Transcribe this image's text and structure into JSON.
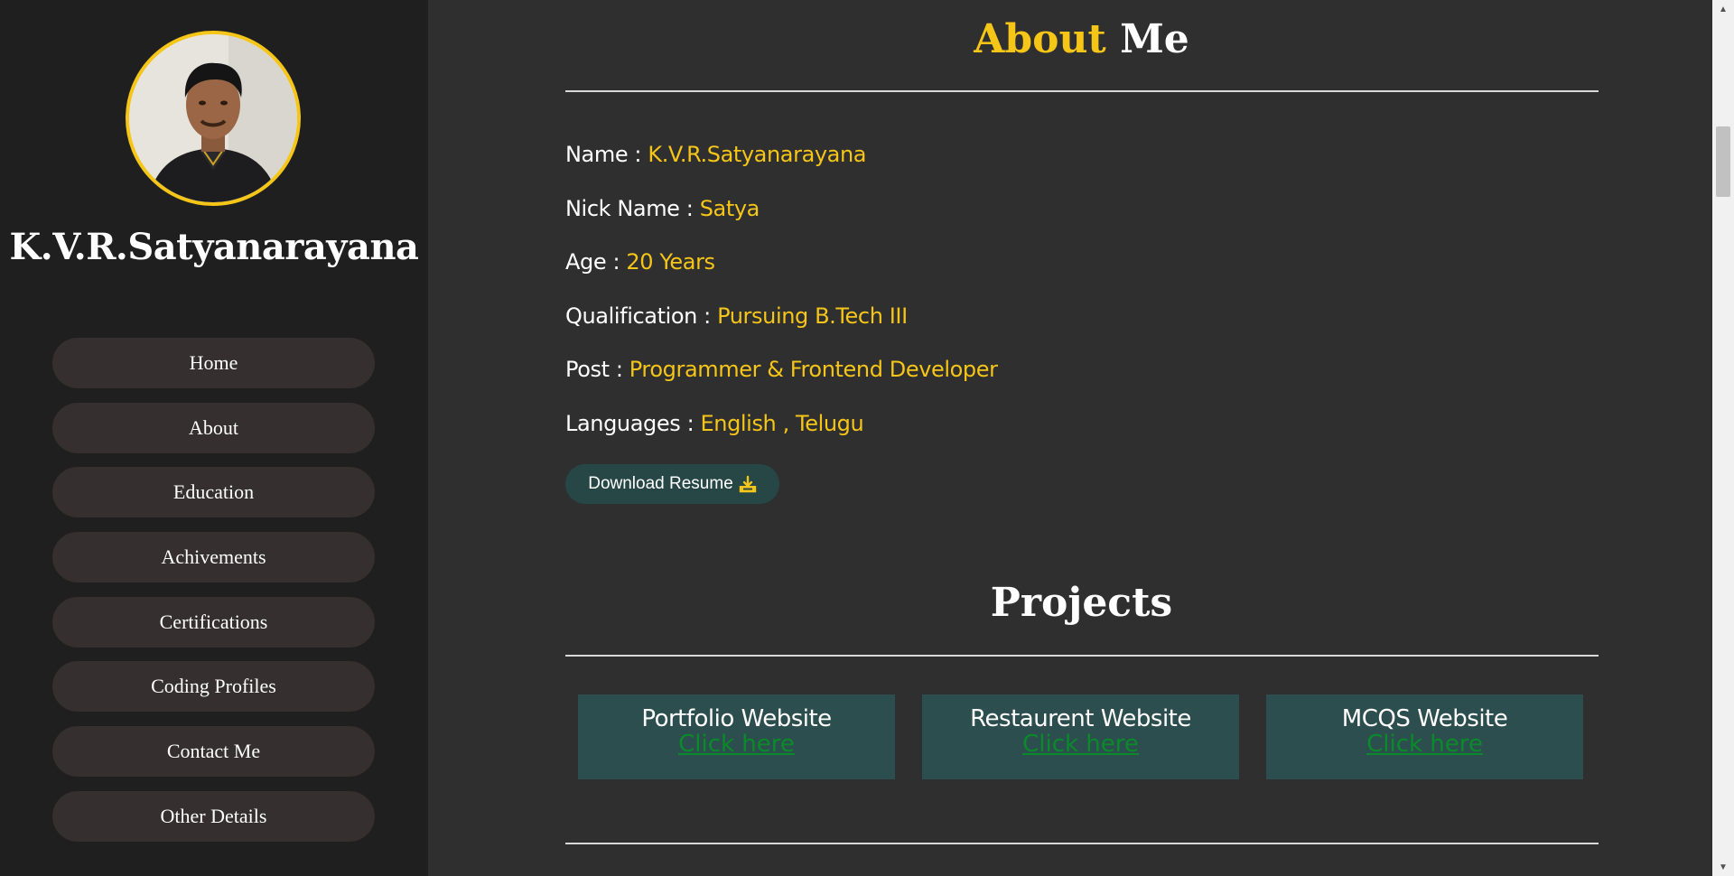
{
  "sidebar": {
    "name": "K.V.R.Satyanarayana",
    "nav": [
      {
        "label": "Home"
      },
      {
        "label": "About"
      },
      {
        "label": "Education"
      },
      {
        "label": "Achivements"
      },
      {
        "label": "Certifications"
      },
      {
        "label": "Coding Profiles"
      },
      {
        "label": "Contact Me"
      },
      {
        "label": "Other Details"
      }
    ]
  },
  "about": {
    "title_accent": "About",
    "title_rest": "Me",
    "fields": [
      {
        "label": "Name :",
        "value": "K.V.R.Satyanarayana"
      },
      {
        "label": "Nick Name :",
        "value": "Satya"
      },
      {
        "label": "Age :",
        "value": "20 Years"
      },
      {
        "label": "Qualification :",
        "value": "Pursuing B.Tech III"
      },
      {
        "label": "Post :",
        "value": "Programmer & Frontend Developer"
      },
      {
        "label": "Languages :",
        "value": "English , Telugu"
      }
    ],
    "resume_button": "Download Resume",
    "resume_icon": "download-icon"
  },
  "projects": {
    "title": "Projects",
    "items": [
      {
        "title": "Portfolio Website",
        "link": "Click here"
      },
      {
        "title": "Restaurent Website",
        "link": "Click here"
      },
      {
        "title": "MCQS Website",
        "link": "Click here"
      }
    ]
  },
  "colors": {
    "accent": "#f5c518",
    "sidebar_bg": "#1f1f1f",
    "main_bg": "#2f2f2f",
    "card_bg": "#2d4e4e",
    "link": "#0a8a2a"
  }
}
